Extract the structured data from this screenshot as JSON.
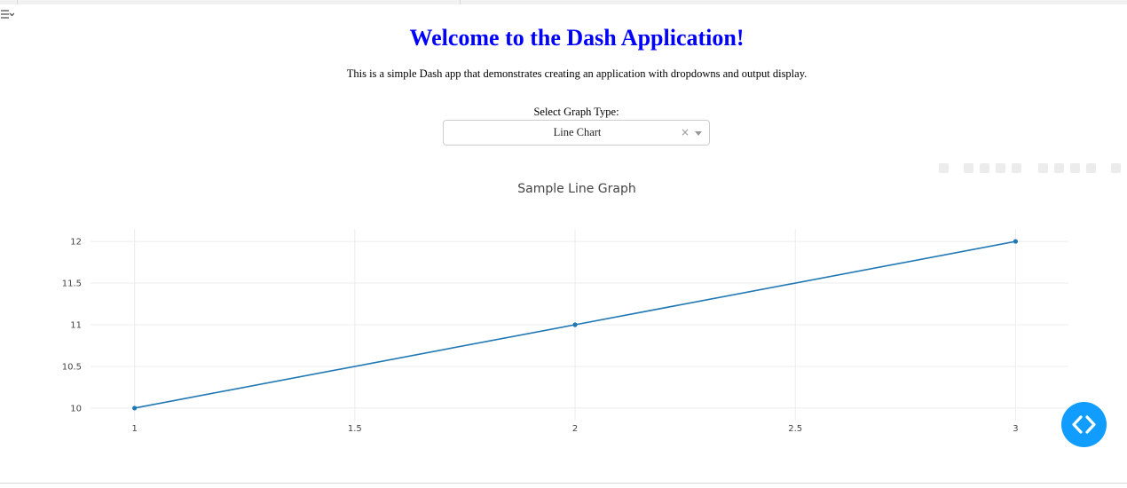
{
  "header": {
    "title": "Welcome to the Dash Application!",
    "subtitle": "This is a simple Dash app that demonstrates creating an application with dropdowns and output display."
  },
  "controls": {
    "graph_type_label": "Select Graph Type:",
    "graph_type_selected": "Line Chart",
    "clear_symbol": "×"
  },
  "graph": {
    "title": "Sample Line Graph",
    "line_color": "#1f77b4"
  },
  "title_color": "#0000ff",
  "fab_color": "#119dff",
  "chart_data": {
    "type": "line",
    "title": "Sample Line Graph",
    "x": [
      1,
      2,
      3
    ],
    "series": [
      {
        "values": [
          10,
          11,
          12
        ]
      }
    ],
    "x_ticks": [
      1,
      1.5,
      2,
      2.5,
      3
    ],
    "y_ticks": [
      10,
      10.5,
      11,
      11.5,
      12
    ],
    "x_tick_labels": [
      "1",
      "1.5",
      "2",
      "2.5",
      "3"
    ],
    "y_tick_labels": [
      "10",
      "10.5",
      "11",
      "11.5",
      "12"
    ],
    "xlim": [
      0.9,
      3.12
    ],
    "ylim": [
      9.85,
      12.15
    ],
    "grid": true,
    "markers": true
  },
  "icons": {
    "corner": "filter-expand-icon",
    "fab": "code-brackets-icon"
  }
}
